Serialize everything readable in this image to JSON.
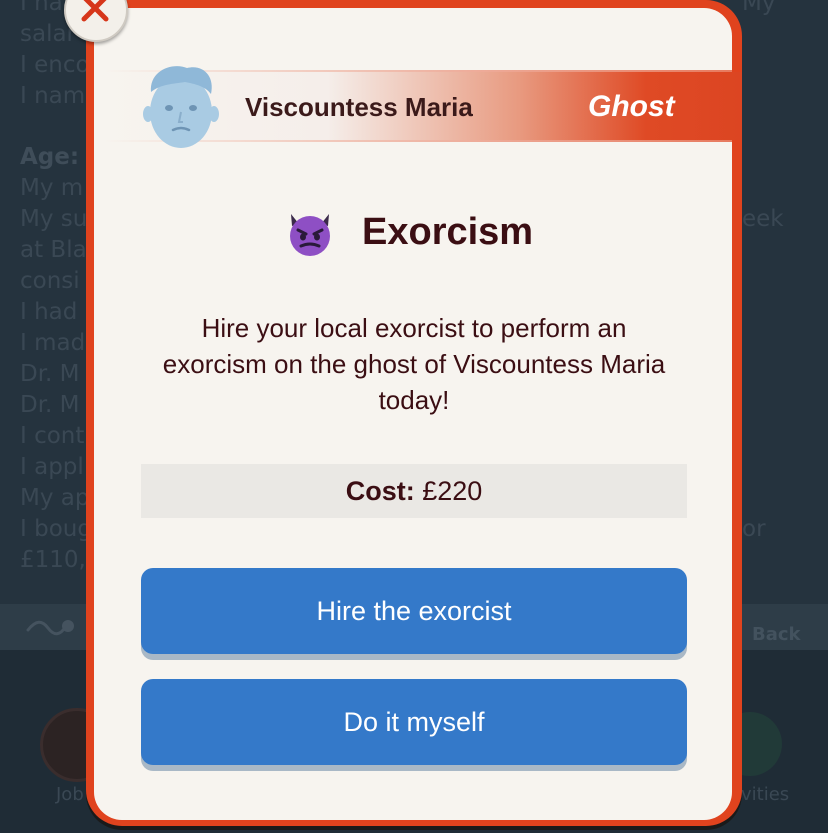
{
  "background": {
    "log_lines": [
      "I ha",
      "salar",
      "I enco",
      "I nam",
      "",
      "Age:",
      "My m",
      "My su",
      "at Bla",
      "consi",
      "I had",
      "I mad",
      "Dr. M",
      "Dr. M",
      "I cont",
      "I appl",
      "My ap",
      "I boug",
      "£110,"
    ],
    "right_fragments": [
      "My",
      "eek",
      "or"
    ],
    "back_label": "Back",
    "tab_left_label": "Job",
    "tab_right_label": "ivities"
  },
  "modal": {
    "person_name": "Viscountess Maria",
    "person_tag": "Ghost",
    "title_emoji_name": "smiling-devil-icon",
    "title": "Exorcism",
    "description": "Hire your local exorcist to perform an exorcism on the ghost of Viscountess Maria today!",
    "cost_label": "Cost:",
    "cost_value": "£220",
    "buttons": [
      {
        "label": "Hire the exorcist"
      },
      {
        "label": "Do it myself"
      }
    ]
  },
  "colors": {
    "modal_border": "#e0431e",
    "modal_background": "#f7f4ef",
    "button": "#3479c9",
    "title_text": "#3b0e13"
  }
}
